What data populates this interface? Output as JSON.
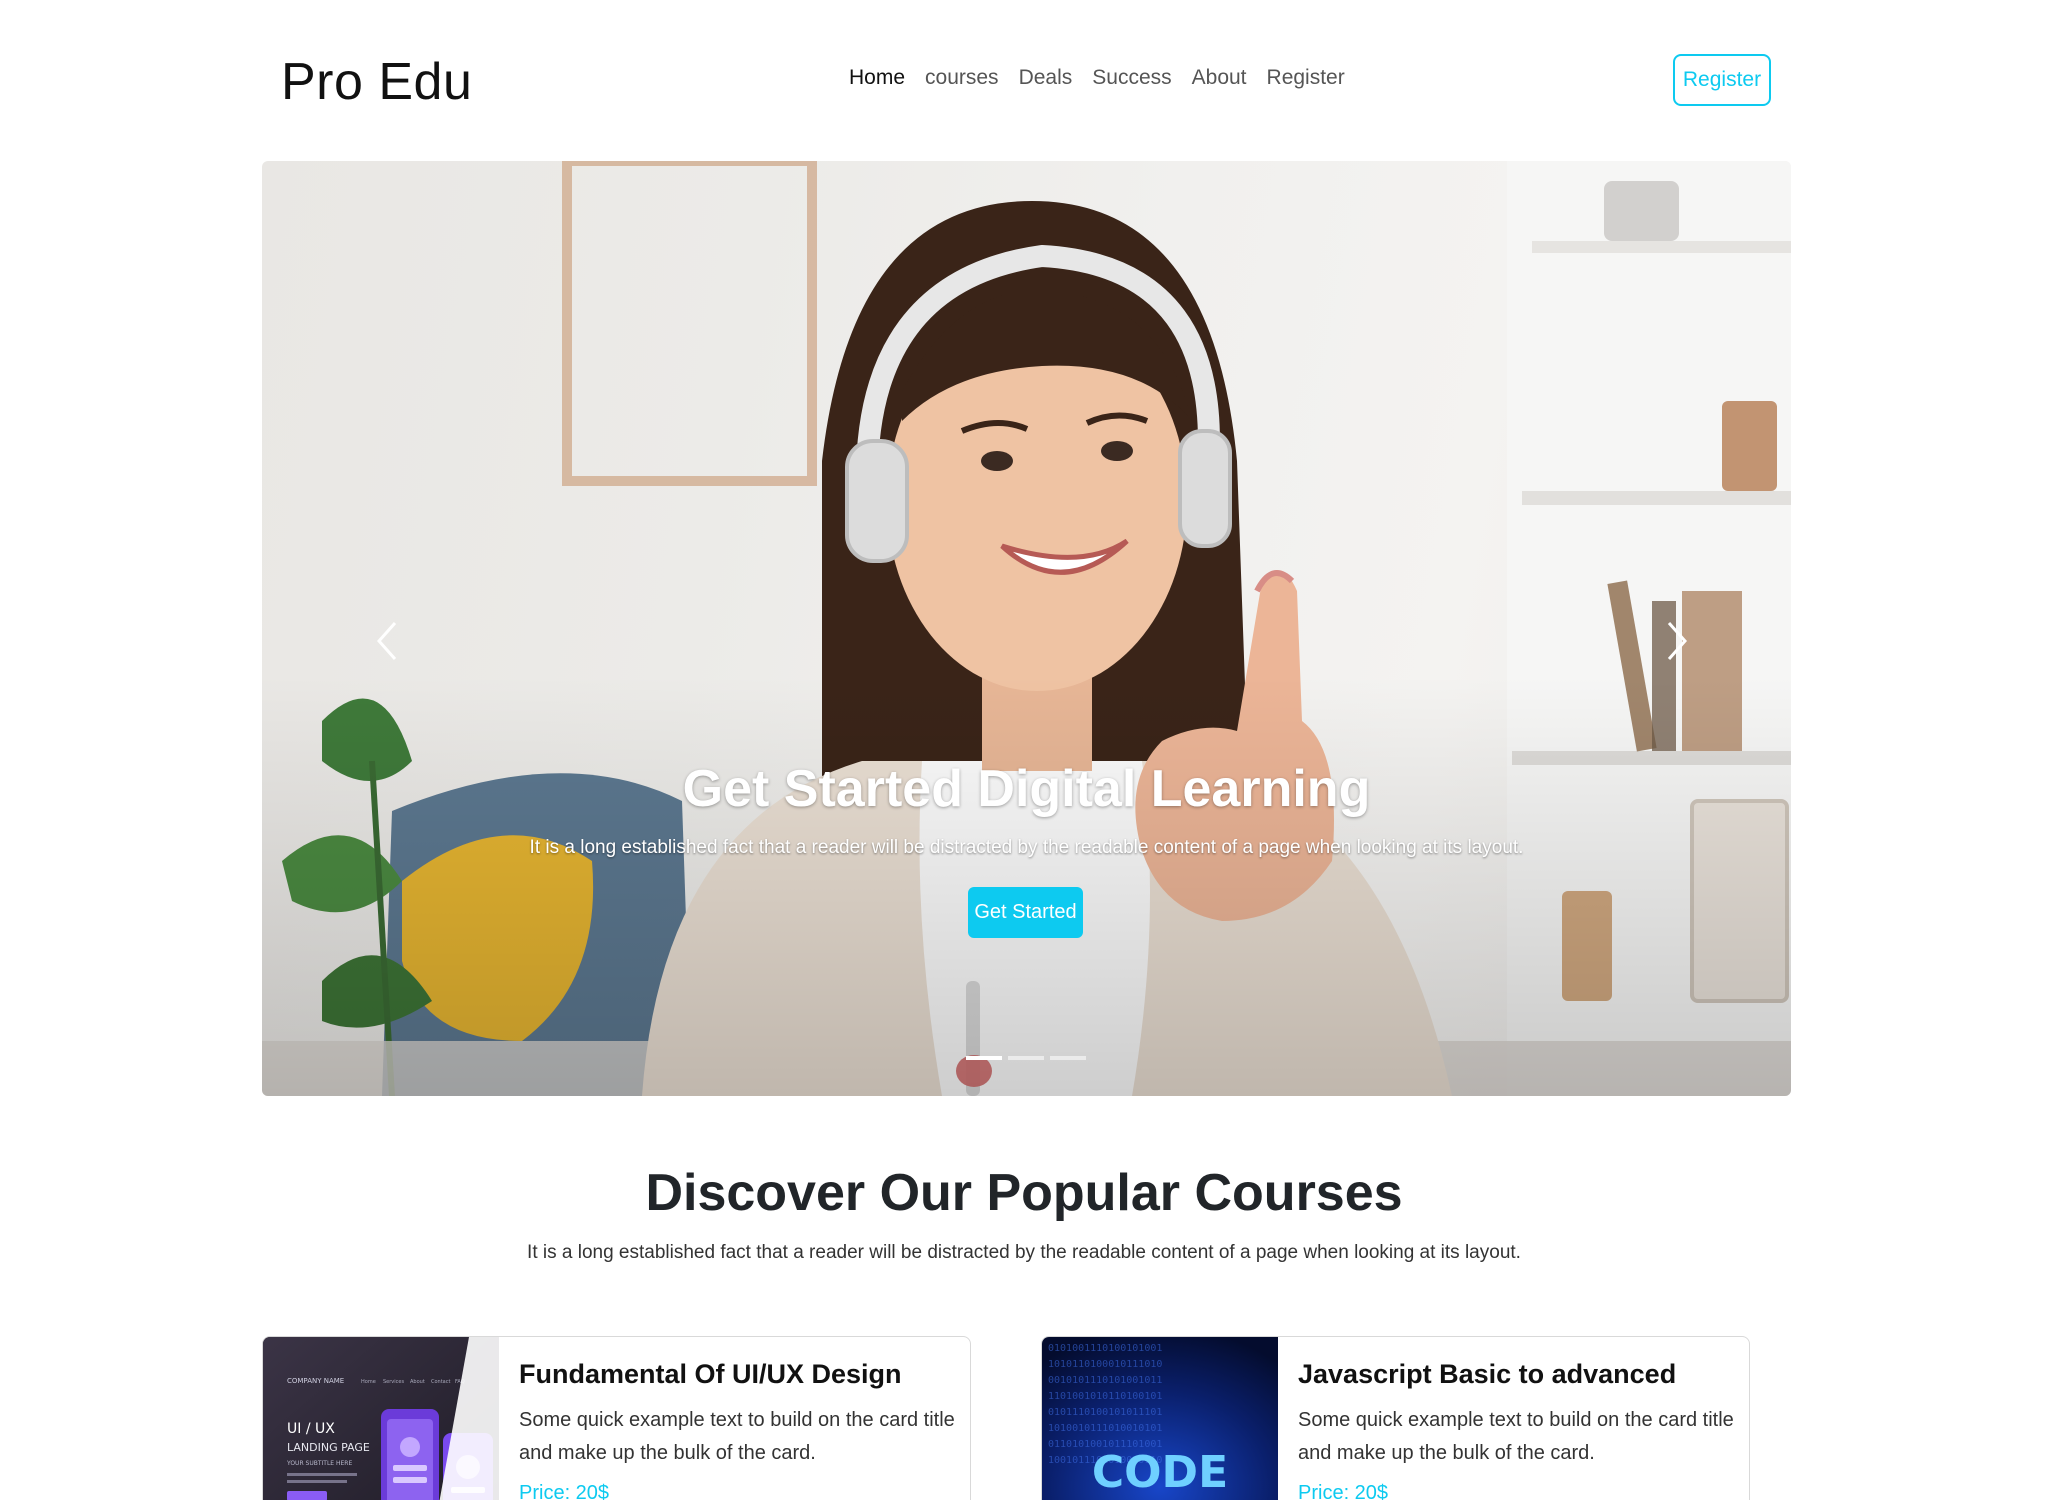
{
  "navbar": {
    "brand": "Pro Edu",
    "links": [
      {
        "label": "Home",
        "active": true
      },
      {
        "label": "courses",
        "active": false
      },
      {
        "label": "Deals",
        "active": false
      },
      {
        "label": "Success",
        "active": false
      },
      {
        "label": "About",
        "active": false
      },
      {
        "label": "Register",
        "active": false
      }
    ],
    "register_button": "Register"
  },
  "hero": {
    "title": "Get Started Digital Learning",
    "text": "It is a long established fact that a reader will be distracted by the readable content of a page when looking at its layout.",
    "button": "Get Started",
    "prev_icon": "chevron-left-icon",
    "next_icon": "chevron-right-icon",
    "slides": 3,
    "active_slide": 1
  },
  "courses_section": {
    "title": "Discover Our Popular Courses",
    "subtitle": "It is a long established fact that a reader will be distracted by the readable content of a page when looking at its layout."
  },
  "courses": [
    {
      "title": "Fundamental Of UI/UX Design",
      "text": "Some quick example text to build on the card title and make up the bulk of the card.",
      "price": "Price: 20$",
      "thumb": {
        "company": "COMPANY NAME",
        "nav": [
          "Home",
          "Services",
          "About",
          "Contact",
          "FAQ"
        ],
        "heading": "UI / UX",
        "subheading": "LANDING PAGE",
        "tagline": "YOUR SUBTITLE HERE"
      }
    },
    {
      "title": "Javascript Basic to advanced",
      "text": "Some quick example text to build on the card title and make up the bulk of the card.",
      "price": "Price: 20$",
      "thumb": {
        "word": "CODE"
      }
    }
  ],
  "colors": {
    "accent": "#0dcaf0",
    "text": "#212529"
  }
}
